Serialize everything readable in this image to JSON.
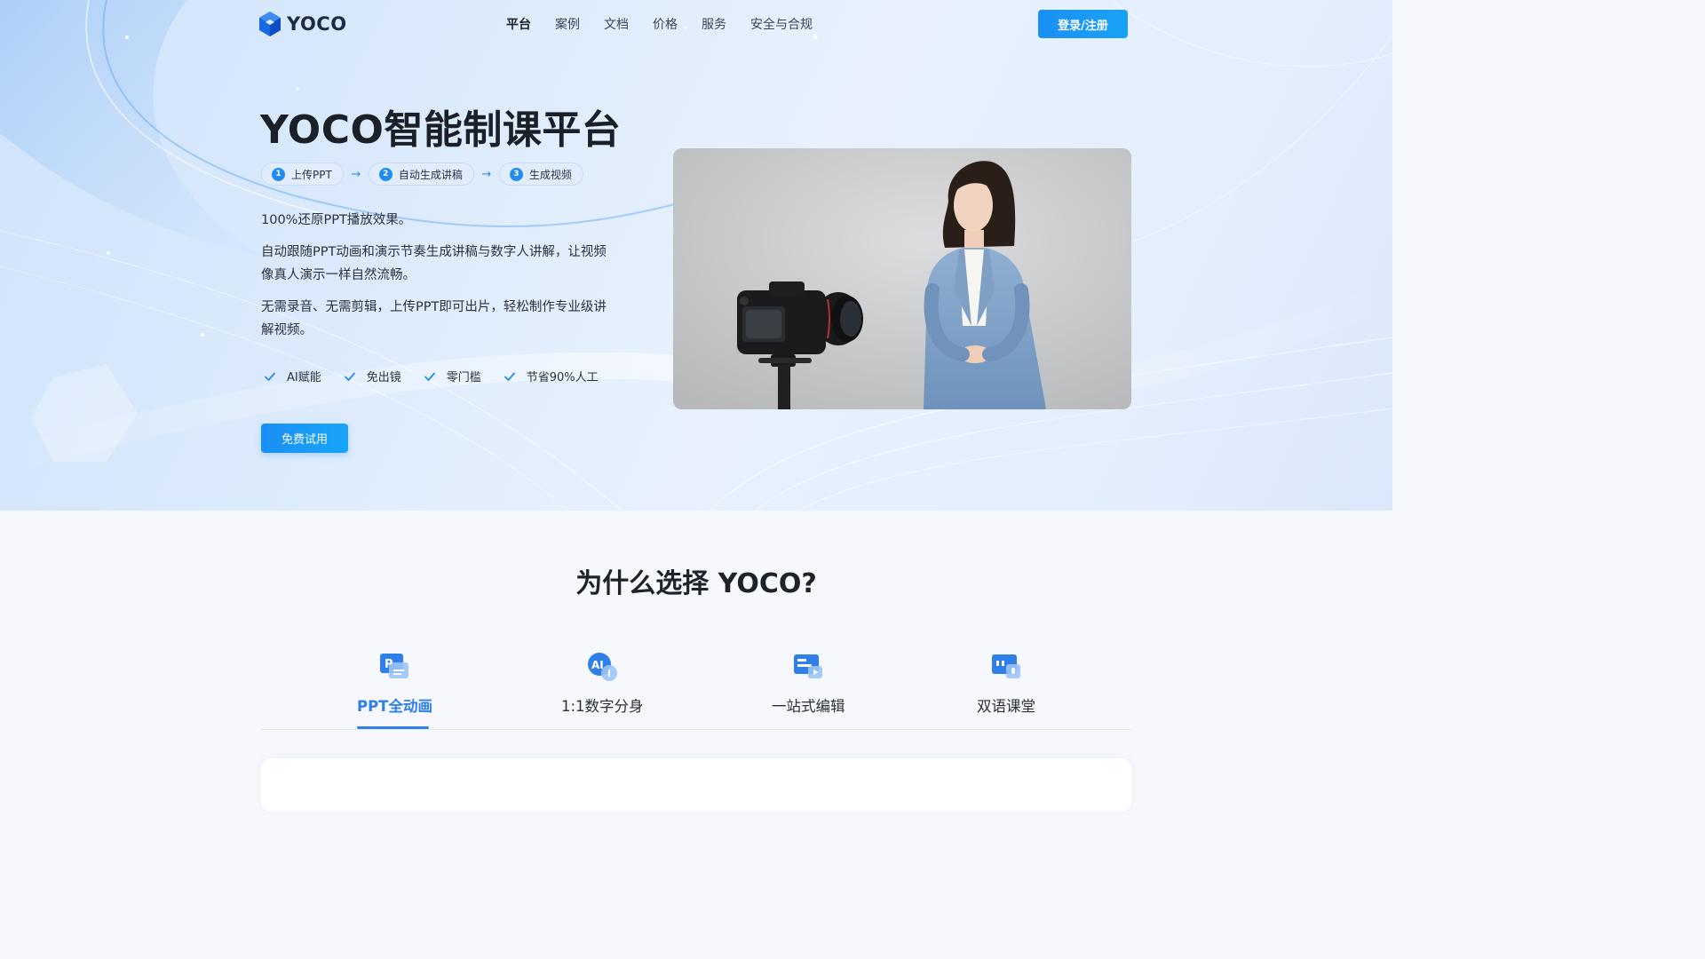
{
  "brand": {
    "name": "YOCO",
    "logo_icon": "hexagon-cube-icon",
    "accent": "#1a8ff5"
  },
  "nav": {
    "items": [
      {
        "label": "平台",
        "active": true
      },
      {
        "label": "案例",
        "active": false
      },
      {
        "label": "文档",
        "active": false
      },
      {
        "label": "价格",
        "active": false
      },
      {
        "label": "服务",
        "active": false
      },
      {
        "label": "安全与合规",
        "active": false
      }
    ],
    "login_label": "登录/注册"
  },
  "hero": {
    "title": "YOCO智能制课平台",
    "steps": [
      {
        "num": "1",
        "label": "上传PPT"
      },
      {
        "num": "2",
        "label": "自动生成讲稿"
      },
      {
        "num": "3",
        "label": "生成视频"
      }
    ],
    "desc1": "100%还原PPT播放效果。",
    "desc2": "自动跟随PPT动画和演示节奏生成讲稿与数字人讲解，让视频像真人演示一样自然流畅。",
    "desc3": "无需录音、无需剪辑，上传PPT即可出片，轻松制作专业级讲解视频。",
    "features": [
      "AI赋能",
      "免出镜",
      "零门槛",
      "节省90%人工"
    ],
    "cta_label": "免费试用",
    "media": {
      "description_icon": "camera-and-presenter-image"
    }
  },
  "why": {
    "title": "为什么选择 YOCO?",
    "tabs": [
      {
        "label": "PPT全动画",
        "icon": "ppt-animation-icon",
        "active": true
      },
      {
        "label": "1:1数字分身",
        "icon": "ai-avatar-icon",
        "active": false
      },
      {
        "label": "一站式编辑",
        "icon": "editor-icon",
        "active": false
      },
      {
        "label": "双语课堂",
        "icon": "bilingual-class-icon",
        "active": false
      }
    ]
  }
}
